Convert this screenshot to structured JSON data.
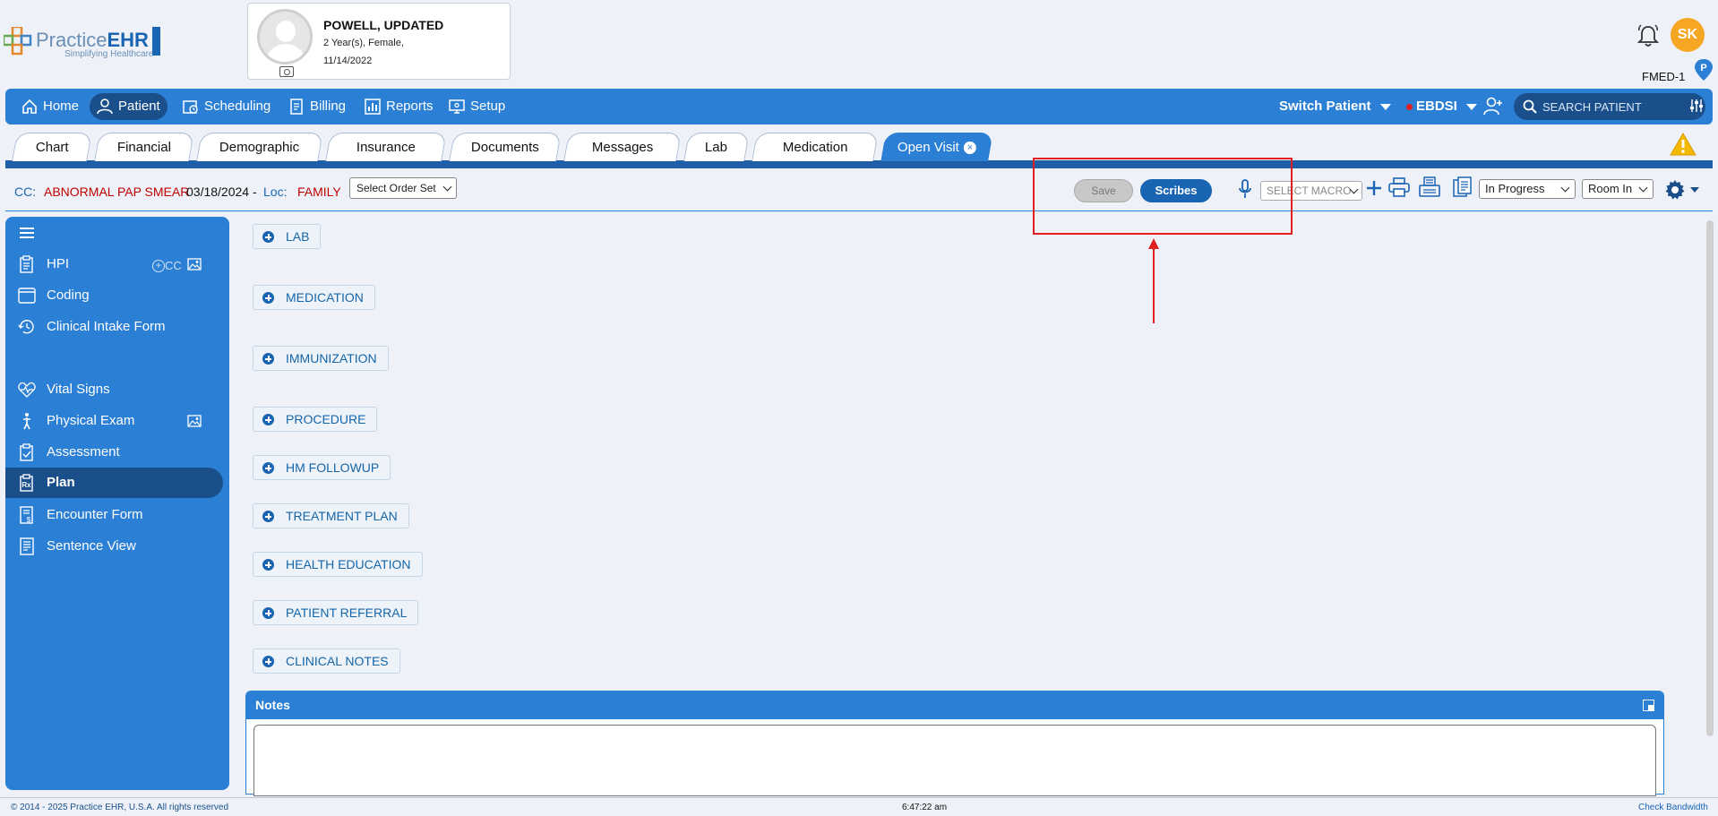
{
  "logo": {
    "brand_light": "Practice",
    "brand_bold": "EHR",
    "tagline": "Simplifying Healthcare"
  },
  "patient": {
    "name": "POWELL, UPDATED",
    "age_gender": "2 Year(s), Female,",
    "dob": "11/14/2022"
  },
  "user": {
    "initials": "SK",
    "facility": "FMED-1"
  },
  "nav": {
    "items": [
      {
        "label": "Home",
        "icon": "home-icon"
      },
      {
        "label": "Patient",
        "icon": "person-icon"
      },
      {
        "label": "Scheduling",
        "icon": "calendar-clock-icon"
      },
      {
        "label": "Billing",
        "icon": "document-icon"
      },
      {
        "label": "Reports",
        "icon": "bar-chart-icon"
      },
      {
        "label": "Setup",
        "icon": "monitor-gear-icon"
      }
    ],
    "switch_patient": "Switch Patient",
    "provider": "EBDSI",
    "search_placeholder": "SEARCH PATIENT"
  },
  "tabs": [
    {
      "label": "Chart"
    },
    {
      "label": "Financial"
    },
    {
      "label": "Demographic"
    },
    {
      "label": "Insurance"
    },
    {
      "label": "Documents"
    },
    {
      "label": "Messages"
    },
    {
      "label": "Lab"
    },
    {
      "label": "Medication"
    },
    {
      "label": "Open Visit"
    }
  ],
  "cc_bar": {
    "cc_label": "CC:",
    "cc_value": "ABNORMAL PAP SMEAR",
    "cc_date": "03/18/2024 -",
    "loc_label": "Loc:",
    "loc_value": "FAMILY",
    "order_set": "Select Order Set",
    "save": "Save",
    "scribes": "Scribes",
    "macro": "SELECT MACRO",
    "status": "In Progress",
    "room": "Room In"
  },
  "sidebar": {
    "hpi_extra": "CC",
    "items": [
      {
        "label": "HPI",
        "icon": "clipboard-icon"
      },
      {
        "label": "Coding",
        "icon": "window-icon"
      },
      {
        "label": "Clinical Intake Form",
        "icon": "history-clock-icon"
      },
      {
        "label": "Vital Signs",
        "icon": "heartbeat-icon"
      },
      {
        "label": "Physical Exam",
        "icon": "body-icon"
      },
      {
        "label": "Assessment",
        "icon": "clipboard-check-icon"
      },
      {
        "label": "Plan",
        "icon": "prescription-icon"
      },
      {
        "label": "Encounter Form",
        "icon": "dollar-document-icon"
      },
      {
        "label": "Sentence View",
        "icon": "text-document-icon"
      }
    ]
  },
  "plan_sections": [
    {
      "label": "LAB"
    },
    {
      "label": "MEDICATION"
    },
    {
      "label": "IMMUNIZATION"
    },
    {
      "label": "PROCEDURE"
    },
    {
      "label": "HM FOLLOWUP"
    },
    {
      "label": "TREATMENT PLAN"
    },
    {
      "label": "HEALTH EDUCATION"
    },
    {
      "label": "PATIENT REFERRAL"
    },
    {
      "label": "CLINICAL NOTES"
    }
  ],
  "notes": {
    "title": "Notes",
    "value": ""
  },
  "footer": {
    "copyright": "© 2014 - 2025 Practice EHR, U.S.A. All rights reserved",
    "time": "6:47:22 am",
    "bandwidth": "Check Bandwidth"
  },
  "colors": {
    "primary": "#2b7fd4",
    "dark": "#1a4f8b",
    "accent_red": "#c00000",
    "annotation": "#e02020"
  }
}
